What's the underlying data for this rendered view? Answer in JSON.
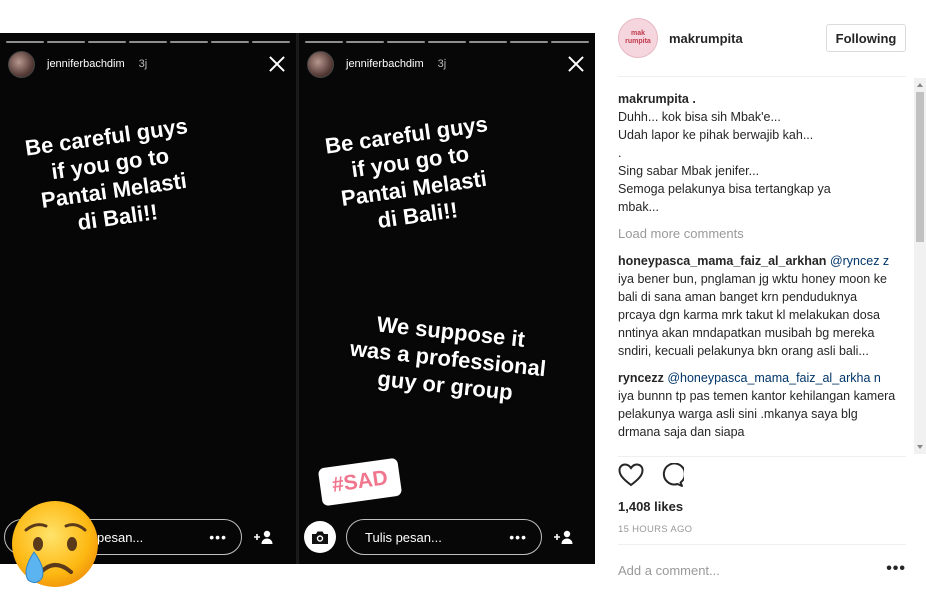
{
  "story": {
    "username": "jenniferbachdim",
    "time": "3j",
    "text_main": "Be careful guys\nif you go to\nPantai Melasti\ndi Bali!!",
    "text_second": "We suppose it\nwas a professional\nguy or group",
    "sticker": "#SAD",
    "reply_placeholder_left": "pesan...",
    "reply_placeholder_right": "Tulis pesan...",
    "reply_more": "•••"
  },
  "post": {
    "account": "makrumpita",
    "logo_text": "mak rumpita",
    "follow_label": "Following",
    "caption_user": "makrumpita",
    "caption_suffix": " .",
    "caption_body": "Duhh... kok bisa sih Mbak'e...\nUdah lapor ke pihak berwajib kah...\n.\nSing sabar Mbak jenifer...\nSemoga pelakunya bisa tertangkap ya\nmbak...",
    "load_more": "Load more comments",
    "comments": [
      {
        "user": "honeypasca_mama_faiz_al_arkhan",
        "mention": "@ryncez z",
        "text": " iya bener bun, pnglaman jg wktu honey moon ke bali di sana aman banget krn penduduknya prcaya dgn karma mrk takut kl melakukan dosa nntinya akan mndapatkan musibah bg mereka sndiri, kecuali pelakunya bkn orang asli bali..."
      },
      {
        "user": "ryncezz",
        "mention": "@honeypasca_mama_faiz_al_arkha n",
        "text": " iya bunnn tp pas temen kantor kehilangan kamera pelakunya warga asli sini .mkanya saya blg drmana saja dan siapa"
      }
    ],
    "likes": "1,408 likes",
    "time_ago": "15 HOURS AGO",
    "add_comment_placeholder": "Add a comment...",
    "more_label": "•••"
  },
  "icons": {
    "heart": "heart-icon",
    "comment": "comment-icon",
    "close": "close-icon",
    "camera": "camera-icon",
    "add_user": "add-user-icon",
    "emoji": "crying-face-emoji"
  }
}
